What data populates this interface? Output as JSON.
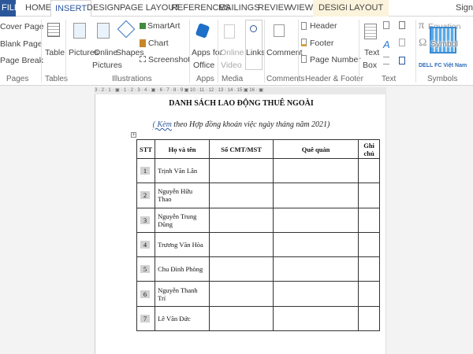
{
  "tabs": [
    "FILE",
    "HOME",
    "INSERT",
    "DESIGN",
    "PAGE LAYOUT",
    "REFERENCES",
    "MAILINGS",
    "REVIEW",
    "VIEW",
    "DESIGN",
    "LAYOUT"
  ],
  "sign_in": "Sign in",
  "ribbon": {
    "pages": {
      "cover": "Cover Page",
      "blank": "Blank Page",
      "break": "Page Break",
      "group": "Pages"
    },
    "tables": {
      "table": "Table",
      "group": "Tables"
    },
    "illustrations": {
      "pictures": "Pictures",
      "online1": "Online",
      "online2": "Pictures",
      "shapes": "Shapes",
      "smartart": "SmartArt",
      "chart": "Chart",
      "screenshot": "Screenshot",
      "group": "Illustrations"
    },
    "apps": {
      "l1": "Apps for",
      "l2": "Office",
      "group": "Apps"
    },
    "media": {
      "l1": "Online",
      "l2": "Video",
      "group": "Media"
    },
    "links": {
      "label": "Links"
    },
    "comments": {
      "comment": "Comment",
      "group": "Comments"
    },
    "hf": {
      "header": "Header",
      "footer": "Footer",
      "pagenum": "Page Number",
      "group": "Header & Footer"
    },
    "text": {
      "l1": "Text",
      "l2": "Box",
      "group": "Text"
    },
    "symbols": {
      "equation": "Equation",
      "symbol": "Symbol",
      "group": "Symbols",
      "watermark": "DELL FC Việt Nam"
    }
  },
  "ruler": "3 · 2 · 1 · ▣ · 1 · 2 · 3 · 4 · ▣ · 6 · 7 · 8 · 9 ▣ 10 · 11 · 12 · 13 · 14 · 15 ▣ 16 · ▣",
  "doc": {
    "title": "DANH SÁCH LAO ĐỘNG THUÊ NGOÀI",
    "sub_kem": "( Kèm",
    "sub_rest": " theo Hợp đồng khoán việc ngày    tháng    năm 2021)",
    "headers": [
      "STT",
      "Họ và tên",
      "Số CMT/MST",
      "Quê quán",
      "Ghi chú"
    ],
    "rows": [
      {
        "stt": "1",
        "name": "Trịnh Văn Lân"
      },
      {
        "stt": "2",
        "name": "Nguyễn Hữu Thao"
      },
      {
        "stt": "3",
        "name": "Nguyễn Trung Dũng"
      },
      {
        "stt": "4",
        "name": "Trương Văn Hòa"
      },
      {
        "stt": "5",
        "name": "Chu Đình Phòng"
      },
      {
        "stt": "6",
        "name": "Nguyễn Thanh Trí"
      },
      {
        "stt": "7",
        "name": "Lê Văn Đức"
      }
    ]
  }
}
